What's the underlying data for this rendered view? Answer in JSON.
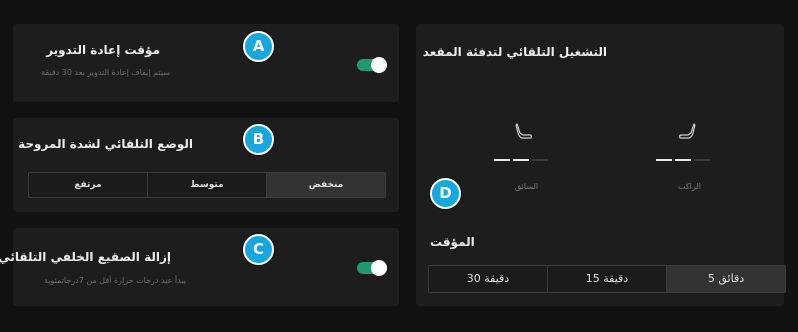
{
  "colors": {
    "background": "#121212",
    "panel": "#1d1d1d",
    "toggle_on": "#1f9a6e",
    "badge": "#16a7de",
    "active_segment": "#333333"
  },
  "recirculation": {
    "title": "مؤقت إعادة التدوير",
    "subtitle": "سيتم إيقاف إعادة التدوير بعد 30 دقيقة",
    "toggle_on": true,
    "badge": "A"
  },
  "fan": {
    "title": "الوضع التلقائي لشدة المروحة",
    "badge": "B",
    "options": [
      "مرتفع",
      "متوسط",
      "منخفض"
    ],
    "selected": "منخفض"
  },
  "defrost": {
    "title": "إزالة الصقيع الخلفي التلقائي",
    "subtitle": "يبدأ عند درجات حرارة أقل من 7درجاتمئوية",
    "toggle_on": true,
    "badge": "C"
  },
  "seat_heating": {
    "title": "التشغيل التلقائي لتدفئة المقعد",
    "badge": "D",
    "passenger": {
      "label": "الراكب",
      "icon": "seat-passenger-icon",
      "level": 2,
      "max_level": 3
    },
    "driver": {
      "label": "السائق",
      "icon": "seat-driver-icon",
      "level": 2,
      "max_level": 3
    }
  },
  "timer": {
    "title": "المؤقت",
    "options": [
      "30 دقيقة",
      "15 دقيقة",
      "5 دقائق"
    ],
    "selected": "5 دقائق"
  }
}
